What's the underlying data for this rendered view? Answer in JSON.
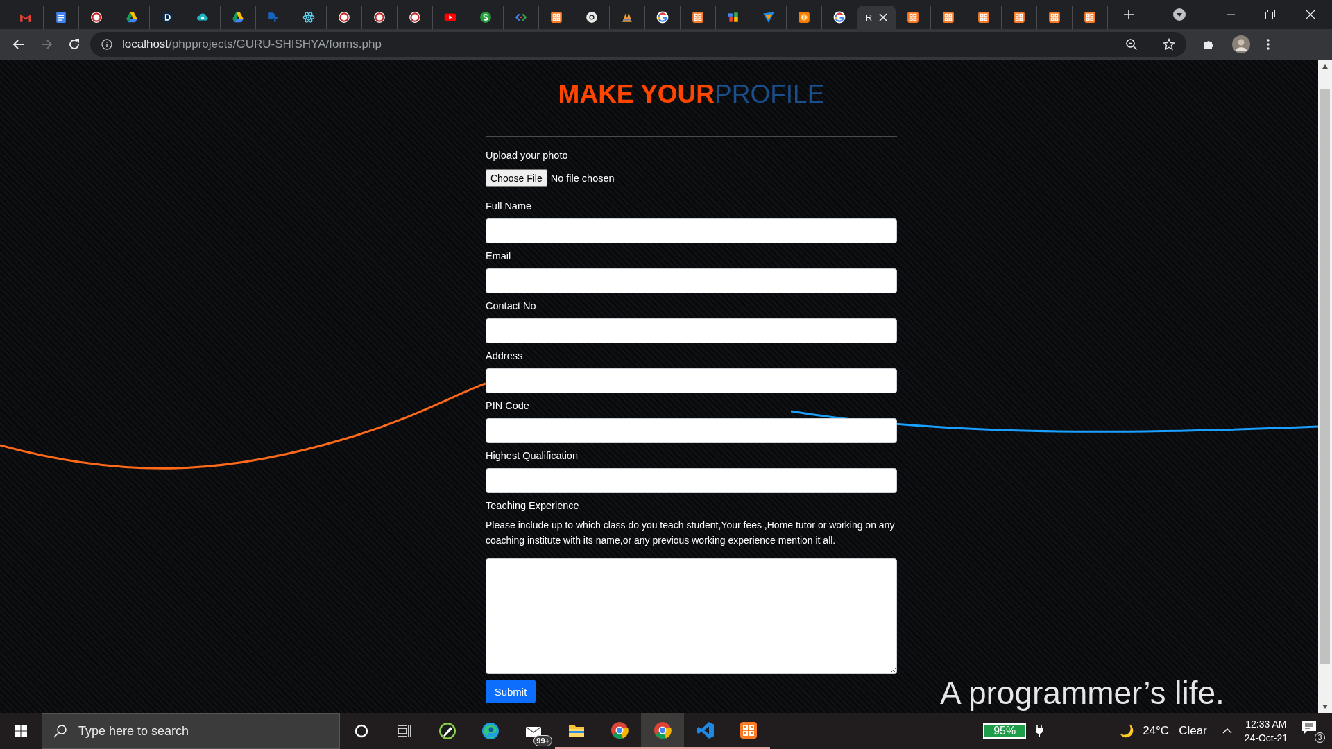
{
  "browser": {
    "tabs": [
      {
        "kind": "gmail",
        "selected": false
      },
      {
        "kind": "docs",
        "selected": false
      },
      {
        "kind": "fall",
        "selected": false
      },
      {
        "kind": "drive",
        "selected": false
      },
      {
        "kind": "letter-d",
        "selected": false
      },
      {
        "kind": "cloud",
        "selected": false
      },
      {
        "kind": "drive",
        "selected": false
      },
      {
        "kind": "d2c",
        "selected": false
      },
      {
        "kind": "react",
        "selected": false
      },
      {
        "kind": "fall",
        "selected": false
      },
      {
        "kind": "fall",
        "selected": false
      },
      {
        "kind": "fall",
        "selected": false
      },
      {
        "kind": "youtube",
        "selected": false
      },
      {
        "kind": "circle-s",
        "selected": false
      },
      {
        "kind": "code",
        "selected": false
      },
      {
        "kind": "xampp",
        "selected": false
      },
      {
        "kind": "chrome",
        "selected": false
      },
      {
        "kind": "pma",
        "selected": false
      },
      {
        "kind": "google",
        "selected": false
      },
      {
        "kind": "xampp",
        "selected": false
      },
      {
        "kind": "seven-b",
        "selected": false
      },
      {
        "kind": "v-logo",
        "selected": false
      },
      {
        "kind": "orange-code",
        "selected": false
      },
      {
        "kind": "google",
        "selected": false
      },
      {
        "kind": "blank",
        "title": "R",
        "selected": true
      },
      {
        "kind": "xampp",
        "selected": false
      },
      {
        "kind": "xampp",
        "selected": false
      },
      {
        "kind": "xampp",
        "selected": false
      },
      {
        "kind": "xampp",
        "selected": false
      },
      {
        "kind": "xampp",
        "selected": false
      },
      {
        "kind": "xampp",
        "selected": false
      }
    ],
    "forward_disabled": true,
    "address": {
      "host": "localhost",
      "path": "/phpprojects/GURU-SHISHYA/forms.php"
    }
  },
  "page": {
    "heading_strong": "MAKE YOUR",
    "heading_light": "PROFILE",
    "photo": {
      "label": "Upload your photo",
      "button": "Choose File",
      "status": "No file chosen"
    },
    "fields": [
      {
        "kind": "input",
        "label": "Full Name"
      },
      {
        "kind": "input",
        "label": "Email"
      },
      {
        "kind": "input",
        "label": "Contact No"
      },
      {
        "kind": "input",
        "label": "Address"
      },
      {
        "kind": "input",
        "label": "PIN Code"
      },
      {
        "kind": "input",
        "label": "Highest Qualification"
      },
      {
        "kind": "textarea",
        "label": "Teaching Experience",
        "hint": "Please include up to which class do you teach student,Your fees ,Home tutor or working on any coaching institute with its name,or any previous working experience mention it all."
      }
    ],
    "submit": "Submit",
    "tagline": "A programmer’s life."
  },
  "taskbar": {
    "search": {
      "placeholder": "Type here to search"
    },
    "apps": [
      {
        "kind": "pen",
        "running": false,
        "selected": false
      },
      {
        "kind": "edge",
        "running": false,
        "selected": false
      },
      {
        "kind": "mail",
        "badge": "99+",
        "running": false,
        "selected": false
      },
      {
        "kind": "folder",
        "running": true,
        "selected": false
      },
      {
        "kind": "chrome",
        "running": true,
        "selected": false
      },
      {
        "kind": "chrome",
        "running": true,
        "selected": true
      },
      {
        "kind": "vscode",
        "running": true,
        "selected": false
      },
      {
        "kind": "xampp",
        "running": true,
        "selected": false
      }
    ],
    "battery": "95%",
    "temperature": "24°C",
    "weather": "Clear",
    "time": "12:33 AM",
    "date": "24-Oct-21",
    "notifications": "3"
  }
}
